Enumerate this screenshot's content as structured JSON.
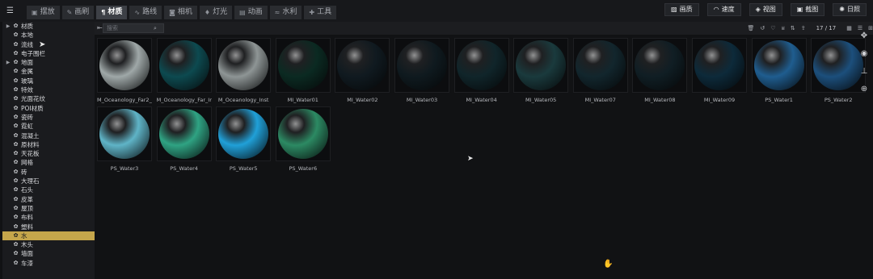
{
  "top_tabs": [
    {
      "label": "摆放",
      "icon": "cube-icon"
    },
    {
      "label": "画刷",
      "icon": "brush-icon"
    },
    {
      "label": "材质",
      "icon": "paint-roller-icon",
      "active": true
    },
    {
      "label": "路线",
      "icon": "route-icon"
    },
    {
      "label": "相机",
      "icon": "camera-icon"
    },
    {
      "label": "灯光",
      "icon": "bulb-icon"
    },
    {
      "label": "动画",
      "icon": "film-icon"
    },
    {
      "label": "水利",
      "icon": "water-icon"
    },
    {
      "label": "工具",
      "icon": "wrench-icon"
    }
  ],
  "right_tools": [
    {
      "label": "画质",
      "icon": "image-icon"
    },
    {
      "label": "速度",
      "icon": "gauge-icon"
    },
    {
      "label": "视图",
      "icon": "view-icon"
    },
    {
      "label": "截图",
      "icon": "screenshot-icon"
    },
    {
      "label": "日照",
      "icon": "sun-icon"
    }
  ],
  "sidebar": {
    "categories": [
      {
        "label": "材质",
        "expandable": true
      },
      {
        "label": "本地"
      },
      {
        "label": "流线"
      },
      {
        "label": "电子围栏"
      },
      {
        "label": "地面",
        "expandable": true
      },
      {
        "label": "金属"
      },
      {
        "label": "玻璃"
      },
      {
        "label": "特效"
      },
      {
        "label": "光面花纹"
      },
      {
        "label": "POI材质"
      },
      {
        "label": "瓷砖"
      },
      {
        "label": "霓虹"
      },
      {
        "label": "混凝土"
      },
      {
        "label": "原材料"
      },
      {
        "label": "天花板"
      },
      {
        "label": "网格"
      },
      {
        "label": "砖"
      },
      {
        "label": "大理石"
      },
      {
        "label": "石头"
      },
      {
        "label": "皮革"
      },
      {
        "label": "屋顶"
      },
      {
        "label": "布料"
      },
      {
        "label": "塑料"
      },
      {
        "label": "水",
        "active": true
      },
      {
        "label": "木头"
      },
      {
        "label": "墙面"
      },
      {
        "label": "车漆"
      }
    ]
  },
  "search": {
    "placeholder": "搜索",
    "value": ""
  },
  "pagination": {
    "text": "17 / 17"
  },
  "materials": [
    {
      "name": "M_Oceanology_Far2_Inst",
      "color": "#9fa8a8"
    },
    {
      "name": "M_Oceanology_Far_Inst",
      "color": "#0d4a50"
    },
    {
      "name": "M_Oceanology_Inst",
      "color": "#8e9595"
    },
    {
      "name": "MI_Water01",
      "color": "#0b2a22"
    },
    {
      "name": "MI_Water02",
      "color": "#101a20"
    },
    {
      "name": "MI_Water03",
      "color": "#0f1a1f"
    },
    {
      "name": "MI_Water04",
      "color": "#10252a"
    },
    {
      "name": "MI_Water05",
      "color": "#1a3a3d"
    },
    {
      "name": "MI_Water07",
      "color": "#12262d"
    },
    {
      "name": "MI_Water08",
      "color": "#101e24"
    },
    {
      "name": "MI_Water09",
      "color": "#0d2a3a"
    },
    {
      "name": "PS_Water1",
      "color": "#1f5d8f"
    },
    {
      "name": "PS_Water2",
      "color": "#1c4f7c"
    },
    {
      "name": "PS_Water3",
      "color": "#5fb4c7"
    },
    {
      "name": "PS_Water4",
      "color": "#2fa383"
    },
    {
      "name": "PS_Water5",
      "color": "#20a0d8"
    },
    {
      "name": "PS_Water6",
      "color": "#2c8a63"
    }
  ],
  "accent_color": "#c5a64b"
}
